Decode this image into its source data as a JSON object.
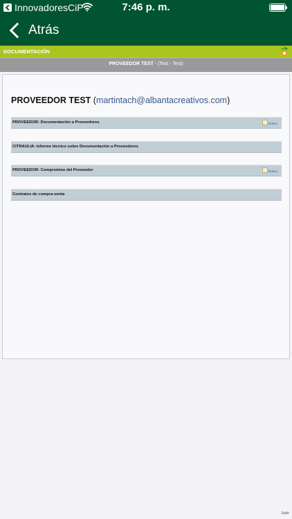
{
  "status_bar": {
    "app_name": "InnovadoresCiP",
    "time": "7:46 p. m."
  },
  "nav": {
    "back_label": "Atrás"
  },
  "section": {
    "title": "DOCUMENTACIÓN"
  },
  "provider_bar": {
    "name": "PROVEEDOR TEST",
    "detail": " - (Test - Test)"
  },
  "user": {
    "name": "PROVEEDOR TEST",
    "email_open": " (",
    "email": "martintach@albantacreativos.com",
    "email_close": ")"
  },
  "documents": [
    {
      "label": "PROVEEDOR: Documentación a Proveedores",
      "badge": "Nuevo"
    },
    {
      "label": "CITRAULIA: Informe técnico sobre Documentación a Proveedores",
      "badge": ""
    },
    {
      "label": "PROVEEDOR: Compromiso del Proveedor",
      "badge": "Nuevo"
    },
    {
      "label": "Contratos de compra-venta",
      "badge": ""
    }
  ],
  "footer": {
    "scroll_top_label": "Subir"
  },
  "colors": {
    "header": "#00542f",
    "section_bar": "#a8c520",
    "provider_bar": "#9a9a9a",
    "row": "#c2ced6",
    "link": "#35568a"
  }
}
